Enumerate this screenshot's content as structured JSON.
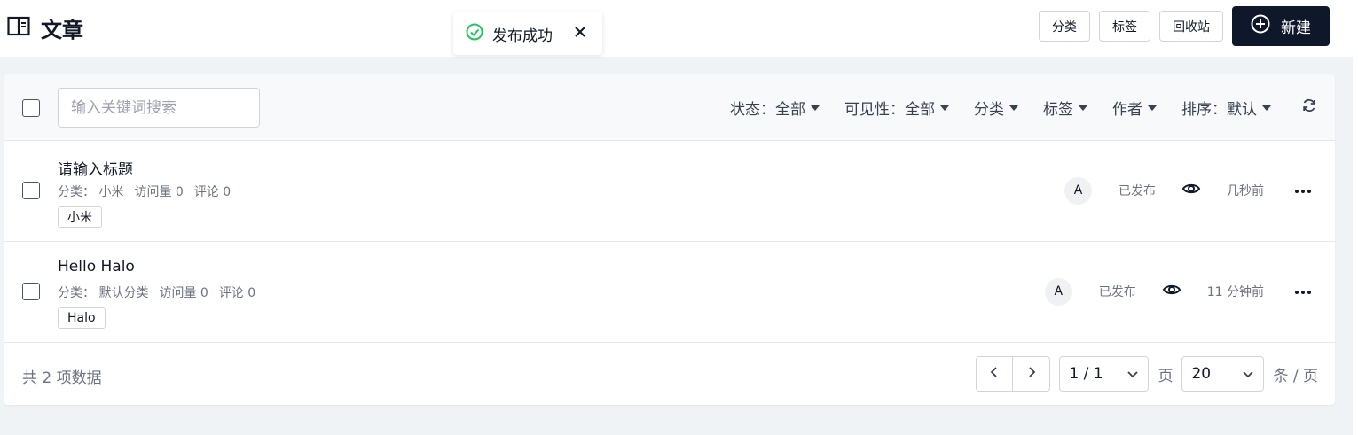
{
  "header": {
    "title": "文章",
    "buttons": {
      "category": "分类",
      "tags": "标签",
      "recycle": "回收站",
      "new": "新建"
    }
  },
  "toast": {
    "message": "发布成功"
  },
  "toolbar": {
    "search_placeholder": "输入关键词搜索",
    "filters": {
      "status": "状态：全部",
      "visibility": "可见性：全部",
      "category": "分类",
      "tag": "标签",
      "author": "作者",
      "sort": "排序：默认"
    }
  },
  "posts": [
    {
      "title": "请输入标题",
      "category": "分类： 小米",
      "visits": "访问量 0",
      "comments": "评论 0",
      "tag": "小米",
      "author_initial": "A",
      "status": "已发布",
      "time": "几秒前"
    },
    {
      "title": "Hello Halo",
      "category": "分类： 默认分类",
      "visits": "访问量 0",
      "comments": "评论 0",
      "tag": "Halo",
      "author_initial": "A",
      "status": "已发布",
      "time": "11 分钟前"
    }
  ],
  "footer": {
    "total": "共 2 项数据",
    "page": "1 / 1",
    "page_unit": "页",
    "page_size": "20",
    "size_unit": "条 / 页"
  }
}
